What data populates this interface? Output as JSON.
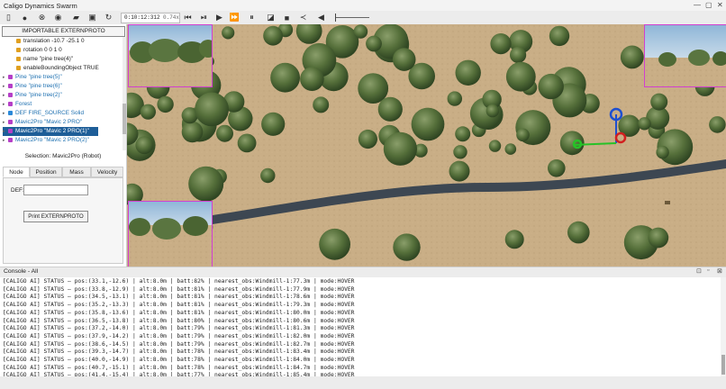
{
  "window": {
    "title": "Caligo Dynamics Swarm",
    "controls": [
      "—",
      "▢",
      "✕"
    ]
  },
  "toolbar": {
    "sim_time": "0:10:12:312",
    "speed": "0.74x",
    "icons": [
      "toggle-panel-icon",
      "record-icon",
      "reset-view-icon",
      "view-eye-icon",
      "open-file-icon",
      "save-file-icon",
      "reload-icon",
      "reset-icon",
      "step-icon",
      "play-icon",
      "fast-forward-icon",
      "pause-icon",
      "screenshot-icon",
      "video-icon",
      "share-icon",
      "volume-icon"
    ]
  },
  "left_panel": {
    "extern_button": "IMPORTABLE EXTERNPROTO",
    "tree": [
      {
        "label": "translation -10.7 -25.1 0",
        "kind": "field",
        "indent": 2,
        "color": "#e0a020"
      },
      {
        "label": "rotation 0 0 1 0",
        "kind": "field",
        "indent": 2,
        "color": "#e0a020"
      },
      {
        "label": "name \"pine tree(4)\"",
        "kind": "field",
        "indent": 2,
        "color": "#e0a020"
      },
      {
        "label": "enableBoundingObject TRUE",
        "kind": "field",
        "indent": 2,
        "color": "#e0a020"
      },
      {
        "label": "Pine \"pine tree(5)\"",
        "kind": "node",
        "indent": 1,
        "color": "#b53fc7"
      },
      {
        "label": "Pine \"pine tree(6)\"",
        "kind": "node",
        "indent": 1,
        "color": "#b53fc7"
      },
      {
        "label": "Pine \"pine tree(2)\"",
        "kind": "node",
        "indent": 1,
        "color": "#b53fc7"
      },
      {
        "label": "Forest",
        "kind": "node",
        "indent": 1,
        "color": "#b53fc7"
      },
      {
        "label": "DEF FIRE_SOURCE Solid",
        "kind": "node",
        "indent": 1,
        "color": "#2a88d8"
      },
      {
        "label": "Mavic2Pro \"Mavic 2 PRO\"",
        "kind": "node",
        "indent": 1,
        "color": "#b53fc7"
      },
      {
        "label": "Mavic2Pro \"Mavic 2 PRO(1)\"",
        "kind": "node",
        "indent": 1,
        "color": "#b53fc7",
        "selected": true
      },
      {
        "label": "Mavic2Pro \"Mavic 2 PRO(2)\"",
        "kind": "node",
        "indent": 1,
        "color": "#b53fc7"
      }
    ],
    "selection": "Selection: Mavic2Pro (Robot)",
    "tabs": [
      "Node",
      "Position",
      "Mass",
      "Velocity"
    ],
    "active_tab": "Node",
    "def_label": "DEF:",
    "def_value": "",
    "print_button": "Print EXTERNPROTO"
  },
  "console": {
    "title": "Console - All",
    "lines": [
      "[CALIGO AI] STATUS — pos:(33.1,-12.6) | alt:8.0m | batt:82% | nearest_obs:Windmill-1:77.3m | mode:HOVER",
      "[CALIGO AI] STATUS — pos:(33.8,-12.9) | alt:8.0m | batt:81% | nearest_obs:Windmill-1:77.9m | mode:HOVER",
      "[CALIGO AI] STATUS — pos:(34.5,-13.1) | alt:8.0m | batt:81% | nearest_obs:Windmill-1:78.6m | mode:HOVER",
      "[CALIGO AI] STATUS — pos:(35.2,-13.3) | alt:8.0m | batt:81% | nearest_obs:Windmill-1:79.3m | mode:HOVER",
      "[CALIGO AI] STATUS — pos:(35.8,-13.6) | alt:8.0m | batt:81% | nearest_obs:Windmill-1:80.0m | mode:HOVER",
      "[CALIGO AI] STATUS — pos:(36.5,-13.8) | alt:8.0m | batt:80% | nearest_obs:Windmill-1:80.6m | mode:HOVER",
      "[CALIGO AI] STATUS — pos:(37.2,-14.0) | alt:8.0m | batt:79% | nearest_obs:Windmill-1:81.3m | mode:HOVER",
      "[CALIGO AI] STATUS — pos:(37.9,-14.2) | alt:8.0m | batt:79% | nearest_obs:Windmill-1:82.0m | mode:HOVER",
      "[CALIGO AI] STATUS — pos:(38.6,-14.5) | alt:8.0m | batt:79% | nearest_obs:Windmill-1:82.7m | mode:HOVER",
      "[CALIGO AI] STATUS — pos:(39.3,-14.7) | alt:8.0m | batt:78% | nearest_obs:Windmill-1:83.4m | mode:HOVER",
      "[CALIGO AI] STATUS — pos:(40.0,-14.9) | alt:8.0m | batt:78% | nearest_obs:Windmill-1:84.0m | mode:HOVER",
      "[CALIGO AI] STATUS — pos:(40.7,-15.1) | alt:8.0m | batt:78% | nearest_obs:Windmill-1:84.7m | mode:HOVER",
      "[CALIGO AI] STATUS — pos:(41.4,-15.4) | alt:8.0m | batt:77% | nearest_obs:Windmill-1:85.4m | mode:HOVER"
    ]
  },
  "colors": {
    "ground": "#c9ae86",
    "road": "#3d4752",
    "foliage": "#4f6a36",
    "selection": "#1e5e98",
    "camera_border": "#d23fd0"
  }
}
